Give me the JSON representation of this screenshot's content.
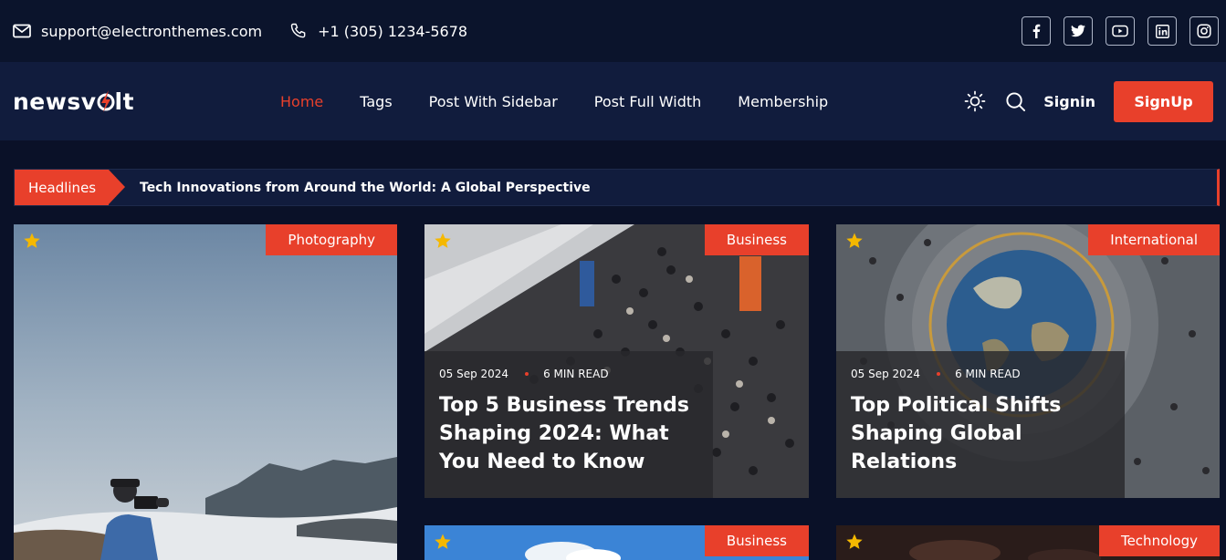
{
  "topbar": {
    "email": "support@electronthemes.com",
    "phone": "+1 (305) 1234-5678",
    "socials": [
      "facebook-icon",
      "twitter-icon",
      "youtube-icon",
      "linkedin-icon",
      "instagram-icon"
    ]
  },
  "nav": {
    "logo_prefix": "newsv",
    "logo_suffix": "lt",
    "links": [
      "Home",
      "Tags",
      "Post With Sidebar",
      "Post Full Width",
      "Membership"
    ],
    "active": "Home",
    "signin": "Signin",
    "signup": "SignUp"
  },
  "ticker": {
    "label": "Headlines",
    "text": "Tech Innovations from Around the World: A Global Perspective"
  },
  "cards": [
    {
      "category": "Photography"
    },
    {
      "category": "Business",
      "date": "05 Sep 2024",
      "read_time": "6 MIN READ",
      "title": "Top 5 Business Trends Shaping 2024: What You Need to Know"
    },
    {
      "category": "International",
      "date": "05 Sep 2024",
      "read_time": "6 MIN READ",
      "title": "Top Political Shifts Shaping Global Relations"
    },
    {
      "category": "Business"
    },
    {
      "category": "Technology"
    }
  ],
  "colors": {
    "accent": "#e8402b",
    "topbar": "#0b142c",
    "navbar": "#111c3d",
    "page": "#0a1128",
    "star": "#f5b800"
  }
}
